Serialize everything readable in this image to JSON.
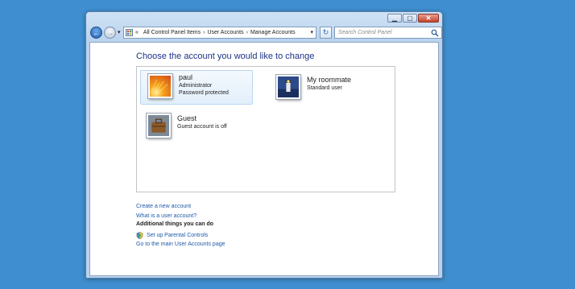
{
  "window": {
    "minimize_label": "▁",
    "maximize_label": "▢",
    "close_label": "✕"
  },
  "nav": {
    "back_icon": "←",
    "forward_icon": "→",
    "dropdown_icon": "▾",
    "refresh_icon": "↻"
  },
  "address": {
    "overflow": "«",
    "crumbs": [
      "All Control Panel Items",
      "User Accounts",
      "Manage Accounts"
    ],
    "separator": "›",
    "dropdown": "▾"
  },
  "search": {
    "placeholder": "Search Control Panel"
  },
  "main": {
    "title": "Choose the account you would like to change",
    "accounts": [
      {
        "name": "paul",
        "line1": "Administrator",
        "line2": "Password protected",
        "selected": true
      },
      {
        "name": "My roommate",
        "line1": "Standard user"
      },
      {
        "name": "Guest",
        "line1": "Guest account is off"
      }
    ],
    "links": {
      "create": "Create a new account",
      "what_is": "What is a user account?"
    },
    "additional": {
      "heading": "Additional things you can do",
      "parental": "Set up Parental Controls",
      "main_page": "Go to the main User Accounts page"
    }
  },
  "colors": {
    "desktop": "#3f8fd0",
    "title_text": "#1e3287",
    "link_text": "#1e5aa8"
  }
}
